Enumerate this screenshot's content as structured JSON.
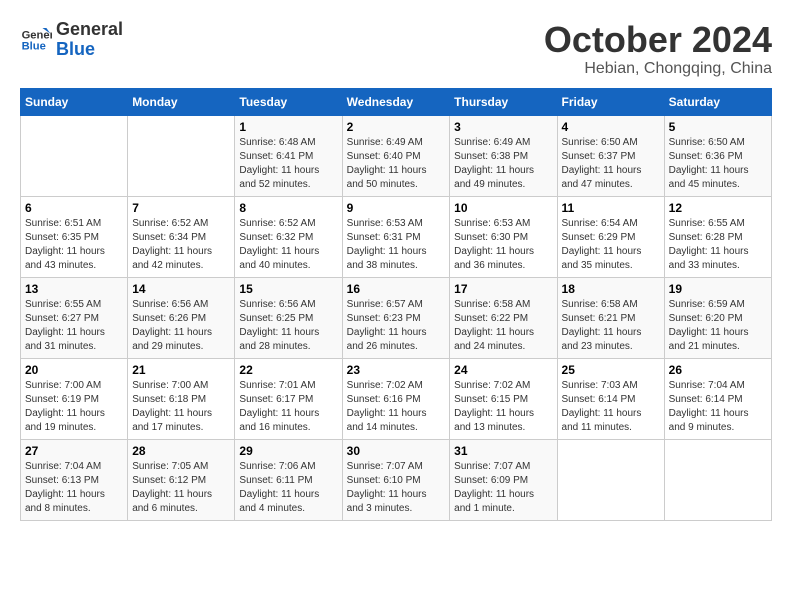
{
  "logo": {
    "line1": "General",
    "line2": "Blue"
  },
  "title": "October 2024",
  "location": "Hebian, Chongqing, China",
  "weekdays": [
    "Sunday",
    "Monday",
    "Tuesday",
    "Wednesday",
    "Thursday",
    "Friday",
    "Saturday"
  ],
  "weeks": [
    [
      {
        "day": "",
        "info": ""
      },
      {
        "day": "",
        "info": ""
      },
      {
        "day": "1",
        "info": "Sunrise: 6:48 AM\nSunset: 6:41 PM\nDaylight: 11 hours and 52 minutes."
      },
      {
        "day": "2",
        "info": "Sunrise: 6:49 AM\nSunset: 6:40 PM\nDaylight: 11 hours and 50 minutes."
      },
      {
        "day": "3",
        "info": "Sunrise: 6:49 AM\nSunset: 6:38 PM\nDaylight: 11 hours and 49 minutes."
      },
      {
        "day": "4",
        "info": "Sunrise: 6:50 AM\nSunset: 6:37 PM\nDaylight: 11 hours and 47 minutes."
      },
      {
        "day": "5",
        "info": "Sunrise: 6:50 AM\nSunset: 6:36 PM\nDaylight: 11 hours and 45 minutes."
      }
    ],
    [
      {
        "day": "6",
        "info": "Sunrise: 6:51 AM\nSunset: 6:35 PM\nDaylight: 11 hours and 43 minutes."
      },
      {
        "day": "7",
        "info": "Sunrise: 6:52 AM\nSunset: 6:34 PM\nDaylight: 11 hours and 42 minutes."
      },
      {
        "day": "8",
        "info": "Sunrise: 6:52 AM\nSunset: 6:32 PM\nDaylight: 11 hours and 40 minutes."
      },
      {
        "day": "9",
        "info": "Sunrise: 6:53 AM\nSunset: 6:31 PM\nDaylight: 11 hours and 38 minutes."
      },
      {
        "day": "10",
        "info": "Sunrise: 6:53 AM\nSunset: 6:30 PM\nDaylight: 11 hours and 36 minutes."
      },
      {
        "day": "11",
        "info": "Sunrise: 6:54 AM\nSunset: 6:29 PM\nDaylight: 11 hours and 35 minutes."
      },
      {
        "day": "12",
        "info": "Sunrise: 6:55 AM\nSunset: 6:28 PM\nDaylight: 11 hours and 33 minutes."
      }
    ],
    [
      {
        "day": "13",
        "info": "Sunrise: 6:55 AM\nSunset: 6:27 PM\nDaylight: 11 hours and 31 minutes."
      },
      {
        "day": "14",
        "info": "Sunrise: 6:56 AM\nSunset: 6:26 PM\nDaylight: 11 hours and 29 minutes."
      },
      {
        "day": "15",
        "info": "Sunrise: 6:56 AM\nSunset: 6:25 PM\nDaylight: 11 hours and 28 minutes."
      },
      {
        "day": "16",
        "info": "Sunrise: 6:57 AM\nSunset: 6:23 PM\nDaylight: 11 hours and 26 minutes."
      },
      {
        "day": "17",
        "info": "Sunrise: 6:58 AM\nSunset: 6:22 PM\nDaylight: 11 hours and 24 minutes."
      },
      {
        "day": "18",
        "info": "Sunrise: 6:58 AM\nSunset: 6:21 PM\nDaylight: 11 hours and 23 minutes."
      },
      {
        "day": "19",
        "info": "Sunrise: 6:59 AM\nSunset: 6:20 PM\nDaylight: 11 hours and 21 minutes."
      }
    ],
    [
      {
        "day": "20",
        "info": "Sunrise: 7:00 AM\nSunset: 6:19 PM\nDaylight: 11 hours and 19 minutes."
      },
      {
        "day": "21",
        "info": "Sunrise: 7:00 AM\nSunset: 6:18 PM\nDaylight: 11 hours and 17 minutes."
      },
      {
        "day": "22",
        "info": "Sunrise: 7:01 AM\nSunset: 6:17 PM\nDaylight: 11 hours and 16 minutes."
      },
      {
        "day": "23",
        "info": "Sunrise: 7:02 AM\nSunset: 6:16 PM\nDaylight: 11 hours and 14 minutes."
      },
      {
        "day": "24",
        "info": "Sunrise: 7:02 AM\nSunset: 6:15 PM\nDaylight: 11 hours and 13 minutes."
      },
      {
        "day": "25",
        "info": "Sunrise: 7:03 AM\nSunset: 6:14 PM\nDaylight: 11 hours and 11 minutes."
      },
      {
        "day": "26",
        "info": "Sunrise: 7:04 AM\nSunset: 6:14 PM\nDaylight: 11 hours and 9 minutes."
      }
    ],
    [
      {
        "day": "27",
        "info": "Sunrise: 7:04 AM\nSunset: 6:13 PM\nDaylight: 11 hours and 8 minutes."
      },
      {
        "day": "28",
        "info": "Sunrise: 7:05 AM\nSunset: 6:12 PM\nDaylight: 11 hours and 6 minutes."
      },
      {
        "day": "29",
        "info": "Sunrise: 7:06 AM\nSunset: 6:11 PM\nDaylight: 11 hours and 4 minutes."
      },
      {
        "day": "30",
        "info": "Sunrise: 7:07 AM\nSunset: 6:10 PM\nDaylight: 11 hours and 3 minutes."
      },
      {
        "day": "31",
        "info": "Sunrise: 7:07 AM\nSunset: 6:09 PM\nDaylight: 11 hours and 1 minute."
      },
      {
        "day": "",
        "info": ""
      },
      {
        "day": "",
        "info": ""
      }
    ]
  ]
}
